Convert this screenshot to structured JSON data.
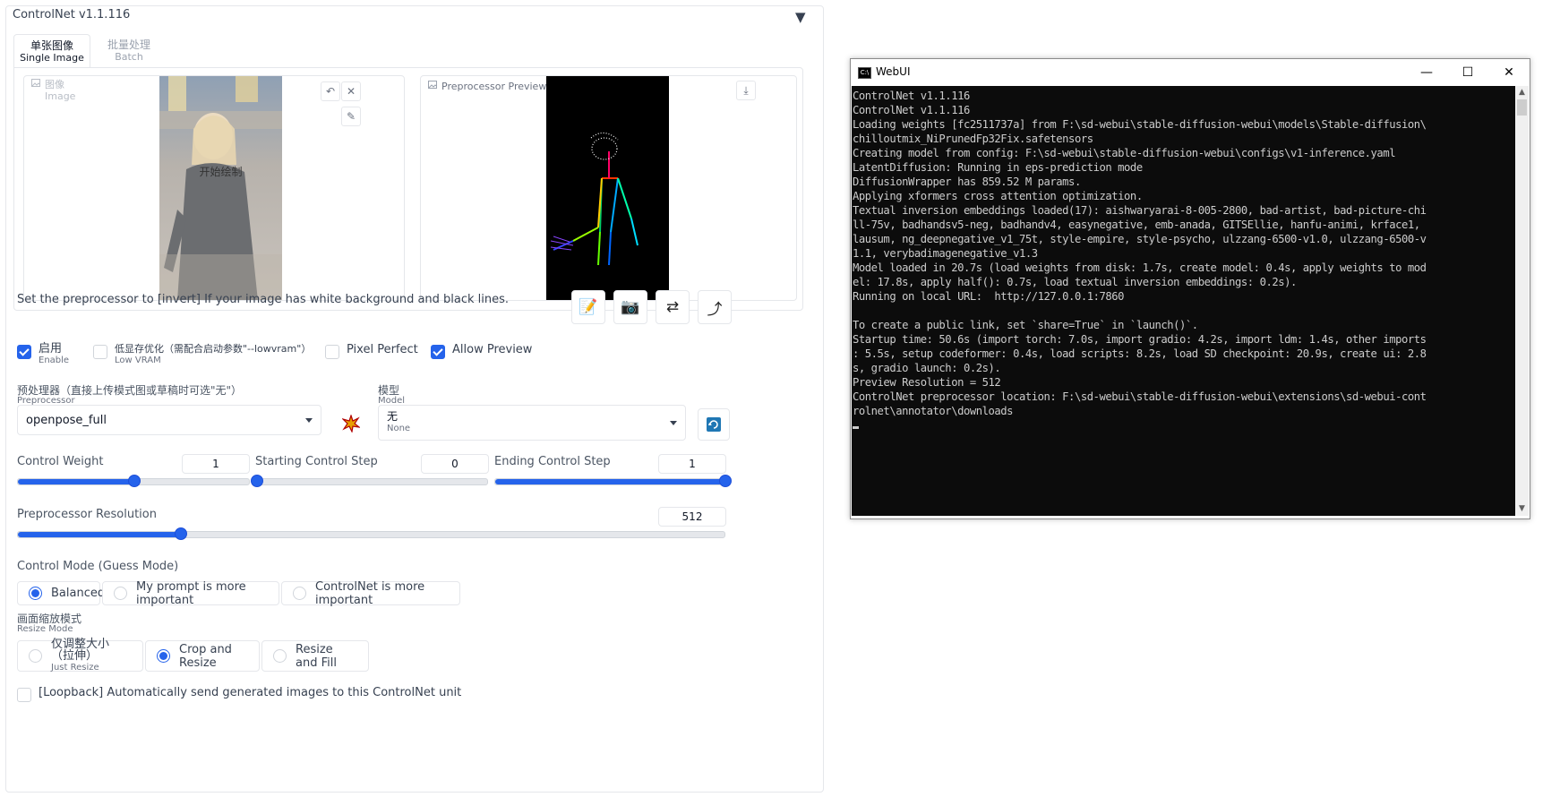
{
  "controlnet": {
    "title": "ControlNet v1.1.116",
    "collapse_icon": "triangle-down-icon",
    "tabs": [
      {
        "label": "单张图像",
        "sub": "Single Image"
      },
      {
        "label": "批量处理",
        "sub": "Batch"
      }
    ],
    "image_panel": {
      "label": "图像",
      "label_sub": "Image",
      "overlay_text": "开始绘制"
    },
    "preview_panel": {
      "label": "Preprocessor Preview"
    },
    "hint": "Set the preprocessor to [invert] If your image has white background and black lines.",
    "checkboxes": {
      "enable": {
        "label": "启用",
        "sub": "Enable",
        "checked": true
      },
      "low_vram": {
        "label": "低显存优化（需配合启动参数\"--lowvram\"）",
        "sub": "Low VRAM",
        "checked": false
      },
      "pixel_perfect": {
        "label": "Pixel Perfect",
        "checked": false
      },
      "allow_preview": {
        "label": "Allow Preview",
        "checked": true
      }
    },
    "preprocessor": {
      "label": "预处理器（直接上传模式图或草稿时可选\"无\"）",
      "sub": "Preprocessor",
      "value": "openpose_full"
    },
    "model": {
      "label": "模型",
      "sub": "Model",
      "value": "无",
      "value_sub": "None"
    },
    "sliders": {
      "control_weight": {
        "label": "Control Weight",
        "value": "1",
        "fraction": 0.5
      },
      "starting_step": {
        "label": "Starting Control Step",
        "value": "0",
        "fraction": 0.0
      },
      "ending_step": {
        "label": "Ending Control Step",
        "value": "1",
        "fraction": 1.0
      },
      "preprocessor_resolution": {
        "label": "Preprocessor Resolution",
        "value": "512",
        "fraction": 0.23
      }
    },
    "control_mode": {
      "label": "Control Mode (Guess Mode)",
      "options": [
        "Balanced",
        "My prompt is more important",
        "ControlNet is more important"
      ],
      "selected": "Balanced"
    },
    "resize_mode": {
      "label": "画面缩放模式",
      "sub": "Resize Mode",
      "options": [
        {
          "label": "仅调整大小（拉伸）",
          "sub": "Just Resize"
        },
        {
          "label": "Crop and Resize",
          "sub": ""
        },
        {
          "label": "Resize and Fill",
          "sub": ""
        }
      ],
      "selected": "Crop and Resize"
    },
    "loopback": {
      "label": "[Loopback] Automatically send generated images to this ControlNet unit",
      "checked": false
    }
  },
  "console": {
    "title": "WebUI",
    "lines": [
      "ControlNet v1.1.116",
      "ControlNet v1.1.116",
      "Loading weights [fc2511737a] from F:\\sd-webui\\stable-diffusion-webui\\models\\Stable-diffusion\\",
      "chilloutmix_NiPrunedFp32Fix.safetensors",
      "Creating model from config: F:\\sd-webui\\stable-diffusion-webui\\configs\\v1-inference.yaml",
      "LatentDiffusion: Running in eps-prediction mode",
      "DiffusionWrapper has 859.52 M params.",
      "Applying xformers cross attention optimization.",
      "Textual inversion embeddings loaded(17): aishwaryarai-8-005-2800, bad-artist, bad-picture-chi",
      "ll-75v, badhandsv5-neg, badhandv4, easynegative, emb-anada, GITSEllie, hanfu-animi, krface1,",
      "lausum, ng_deepnegative_v1_75t, style-empire, style-psycho, ulzzang-6500-v1.0, ulzzang-6500-v",
      "1.1, verybadimagenegative_v1.3",
      "Model loaded in 20.7s (load weights from disk: 1.7s, create model: 0.4s, apply weights to mod",
      "el: 17.8s, apply half(): 0.7s, load textual inversion embeddings: 0.2s).",
      "Running on local URL:  http://127.0.0.1:7860",
      "",
      "To create a public link, set `share=True` in `launch()`.",
      "Startup time: 50.6s (import torch: 7.0s, import gradio: 4.2s, import ldm: 1.4s, other imports",
      ": 5.5s, setup codeformer: 0.4s, load scripts: 8.2s, load SD checkpoint: 20.9s, create ui: 2.8",
      "s, gradio launch: 0.2s).",
      "Preview Resolution = 512",
      "ControlNet preprocessor location: F:\\sd-webui\\stable-diffusion-webui\\extensions\\sd-webui-cont",
      "rolnet\\annotator\\downloads"
    ],
    "controls": {
      "minimize": "—",
      "maximize": "☐",
      "close": "✕"
    }
  }
}
